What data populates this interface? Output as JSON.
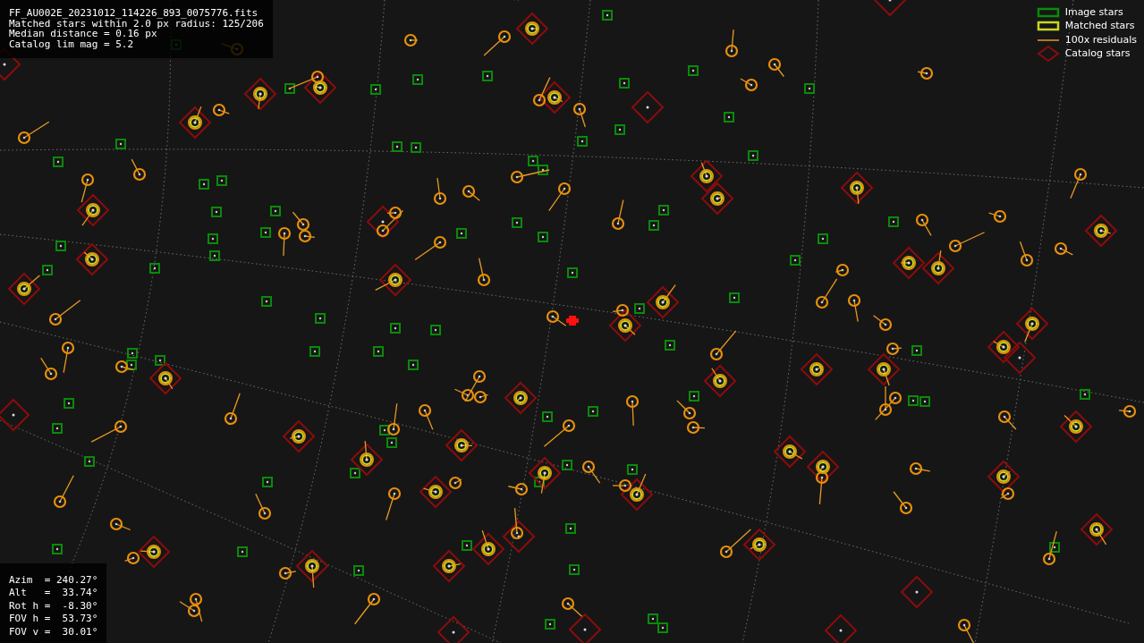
{
  "info_panel": {
    "lines": [
      "FF_AU002E_20231012_114226_893_0075776.fits",
      "Matched stars within 2.0 px radius: 125/206",
      "Median distance = 0.16 px",
      "Catalog lim mag = 5.2"
    ]
  },
  "legend": {
    "items": [
      {
        "kind": "image",
        "label": "Image stars"
      },
      {
        "kind": "matched",
        "label": "Matched stars"
      },
      {
        "kind": "residual",
        "label": "100x residuals"
      },
      {
        "kind": "catalog",
        "label": "Catalog stars"
      }
    ]
  },
  "pointing_panel": {
    "lines": [
      "Azim  = 240.27°",
      "Alt   =  33.74°",
      "Rot h =  -8.30°",
      "FOV h =  53.73°",
      "FOV v =  30.01°"
    ]
  }
}
